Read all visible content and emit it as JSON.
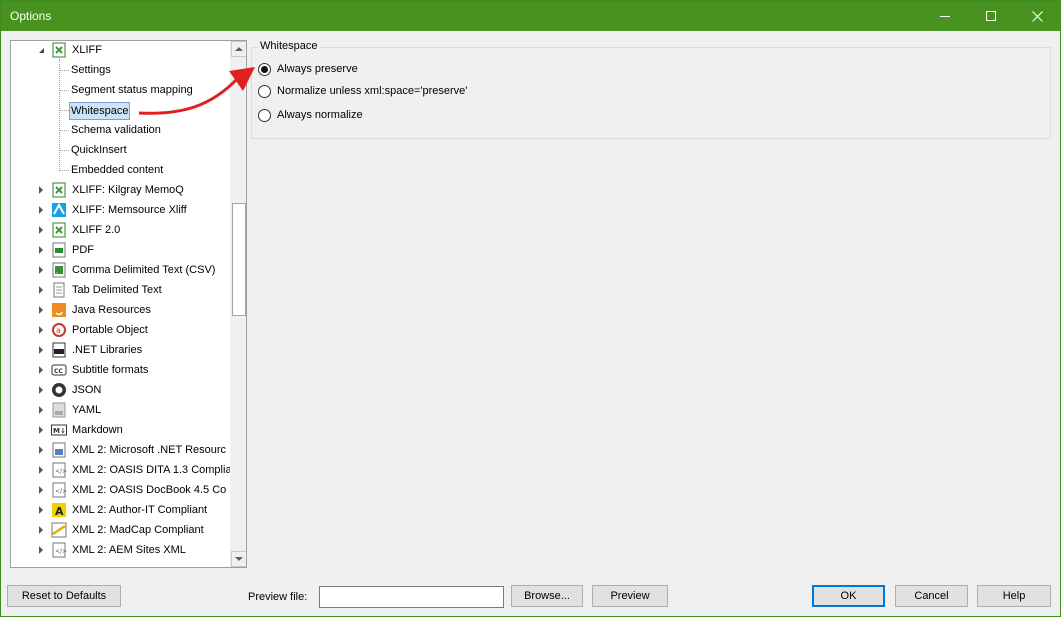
{
  "window": {
    "title": "Options"
  },
  "tree": {
    "items": [
      {
        "label": "XLIFF",
        "level": 0,
        "icon": "xliff-icon",
        "expanded": true
      },
      {
        "label": "Settings",
        "level": 1
      },
      {
        "label": "Segment status mapping",
        "level": 1
      },
      {
        "label": "Whitespace",
        "level": 1,
        "selected": true
      },
      {
        "label": "Schema validation",
        "level": 1
      },
      {
        "label": "QuickInsert",
        "level": 1
      },
      {
        "label": "Embedded content",
        "level": 1
      },
      {
        "label": "XLIFF: Kilgray MemoQ",
        "level": 0,
        "icon": "xliff-icon"
      },
      {
        "label": "XLIFF: Memsource Xliff",
        "level": 0,
        "icon": "memsource-icon"
      },
      {
        "label": "XLIFF 2.0",
        "level": 0,
        "icon": "xliff-icon"
      },
      {
        "label": "PDF",
        "level": 0,
        "icon": "pdf-icon"
      },
      {
        "label": "Comma Delimited Text (CSV)",
        "level": 0,
        "icon": "csv-icon"
      },
      {
        "label": "Tab Delimited Text",
        "level": 0,
        "icon": "text-file-icon"
      },
      {
        "label": "Java Resources",
        "level": 0,
        "icon": "java-icon"
      },
      {
        "label": "Portable Object",
        "level": 0,
        "icon": "portable-object-icon"
      },
      {
        "label": ".NET Libraries",
        "level": 0,
        "icon": "dotnet-icon"
      },
      {
        "label": "Subtitle formats",
        "level": 0,
        "icon": "subtitle-icon"
      },
      {
        "label": "JSON",
        "level": 0,
        "icon": "json-icon"
      },
      {
        "label": "YAML",
        "level": 0,
        "icon": "yaml-icon"
      },
      {
        "label": "Markdown",
        "level": 0,
        "icon": "markdown-icon"
      },
      {
        "label": "XML 2: Microsoft .NET Resourc",
        "level": 0,
        "icon": "xml-resx-icon"
      },
      {
        "label": "XML 2: OASIS DITA 1.3 Complia",
        "level": 0,
        "icon": "xml-file-icon"
      },
      {
        "label": "XML 2: OASIS DocBook 4.5 Co",
        "level": 0,
        "icon": "xml-file-icon"
      },
      {
        "label": "XML 2: Author-IT Compliant",
        "level": 0,
        "icon": "author-it-icon"
      },
      {
        "label": "XML 2: MadCap Compliant",
        "level": 0,
        "icon": "madcap-icon"
      },
      {
        "label": "XML 2: AEM Sites XML",
        "level": 0,
        "icon": "xml-file-icon"
      }
    ]
  },
  "whitespace": {
    "title": "Whitespace",
    "options": [
      {
        "label": "Always preserve",
        "checked": true
      },
      {
        "label": "Normalize unless xml:space='preserve'",
        "checked": false
      },
      {
        "label": "Always normalize",
        "checked": false
      }
    ]
  },
  "footer": {
    "reset_label": "Reset to Defaults",
    "preview_file_label": "Preview file:",
    "preview_file_value": "",
    "browse_label": "Browse...",
    "preview_label": "Preview",
    "ok_label": "OK",
    "cancel_label": "Cancel",
    "help_label": "Help"
  },
  "colors": {
    "titlebar": "#48931f",
    "selection": "#cce4f7",
    "annotation_arrow": "#e02020"
  }
}
